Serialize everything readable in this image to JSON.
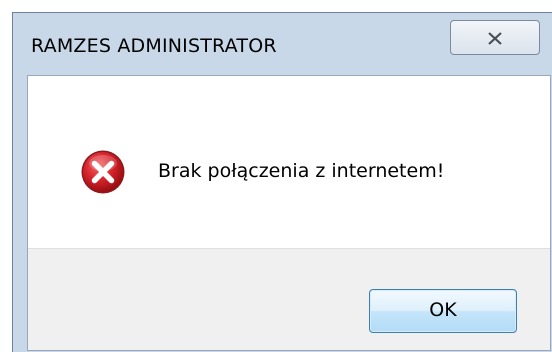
{
  "window": {
    "title": "RAMZES ADMINISTRATOR",
    "close_icon": "close-icon"
  },
  "message": {
    "icon": "error-icon",
    "text": "Brak połączenia z internetem!"
  },
  "buttons": {
    "ok_label": "OK"
  },
  "colors": {
    "frame": "#c9d8e8",
    "footer": "#f0f0f0",
    "error_red": "#c8161d",
    "ok_border": "#3c7fb1"
  }
}
